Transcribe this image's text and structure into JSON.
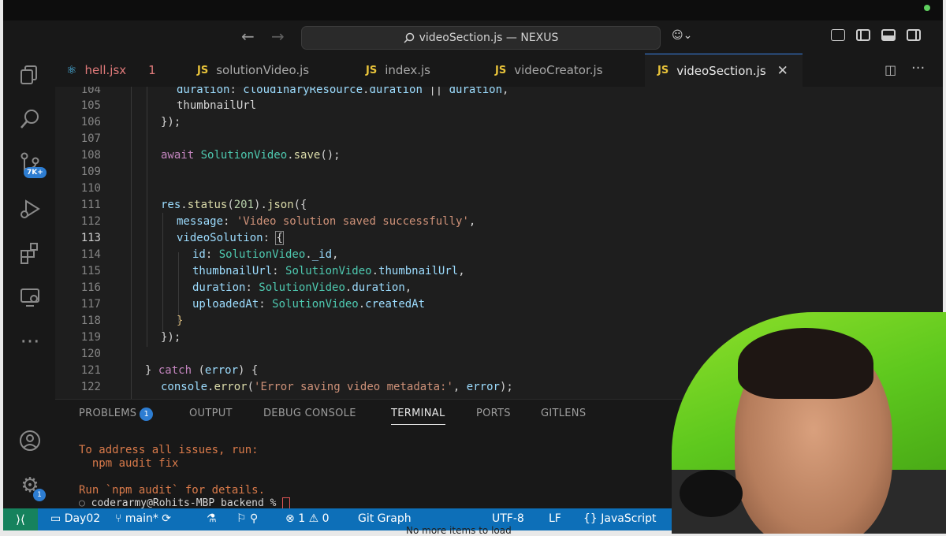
{
  "window": {
    "title": "videoSection.js — NEXUS"
  },
  "tabs": [
    {
      "label": "hell.jsx",
      "icon": "react-icon",
      "badge": "1"
    },
    {
      "label": "solutionVideo.js",
      "icon": "JS"
    },
    {
      "label": "index.js",
      "icon": "JS"
    },
    {
      "label": "videoCreator.js",
      "icon": "JS"
    },
    {
      "label": "videoSection.js",
      "icon": "JS",
      "active": true
    }
  ],
  "activity": {
    "source_control_badge": "7K+",
    "accounts_badge": "1"
  },
  "editor": {
    "lines": [
      {
        "n": "104",
        "text": "duration: cloudinaryResource.duration || duration,"
      },
      {
        "n": "105",
        "text": "thumbnailUrl"
      },
      {
        "n": "106",
        "text": "});"
      },
      {
        "n": "107",
        "text": ""
      },
      {
        "n": "108",
        "text": "await SolutionVideo.save();"
      },
      {
        "n": "109",
        "text": ""
      },
      {
        "n": "110",
        "text": ""
      },
      {
        "n": "111",
        "text": "res.status(201).json({"
      },
      {
        "n": "112",
        "text": "message: 'Video solution saved successfully',"
      },
      {
        "n": "113",
        "text": "videoSolution: {"
      },
      {
        "n": "114",
        "text": "id: SolutionVideo._id,"
      },
      {
        "n": "115",
        "text": "thumbnailUrl: SolutionVideo.thumbnailUrl,"
      },
      {
        "n": "116",
        "text": "duration: SolutionVideo.duration,"
      },
      {
        "n": "117",
        "text": "uploadedAt: SolutionVideo.createdAt"
      },
      {
        "n": "118",
        "text": "}"
      },
      {
        "n": "119",
        "text": "});"
      },
      {
        "n": "120",
        "text": ""
      },
      {
        "n": "121",
        "text": "} catch (error) {"
      },
      {
        "n": "122",
        "text": "console.error('Error saving video metadata:', error);"
      }
    ]
  },
  "panel": {
    "tabs": [
      "PROBLEMS",
      "OUTPUT",
      "DEBUG CONSOLE",
      "TERMINAL",
      "PORTS",
      "GITLENS"
    ],
    "problems_badge": "1",
    "active_tab": "TERMINAL",
    "terminal_lines": [
      "To address all issues, run:",
      "  npm audit fix",
      "",
      "Run `npm audit` for details.",
      "coderarmy@Rohits-MBP backend % "
    ]
  },
  "statusbar": {
    "remote_icon": "remote-icon",
    "workspace": "Day02",
    "branch": "main*",
    "errors": "1",
    "warnings": "0",
    "git_graph": "Git Graph",
    "encoding": "UTF-8",
    "eol": "LF",
    "language": "JavaScript"
  },
  "footer_text": "No more items to load"
}
